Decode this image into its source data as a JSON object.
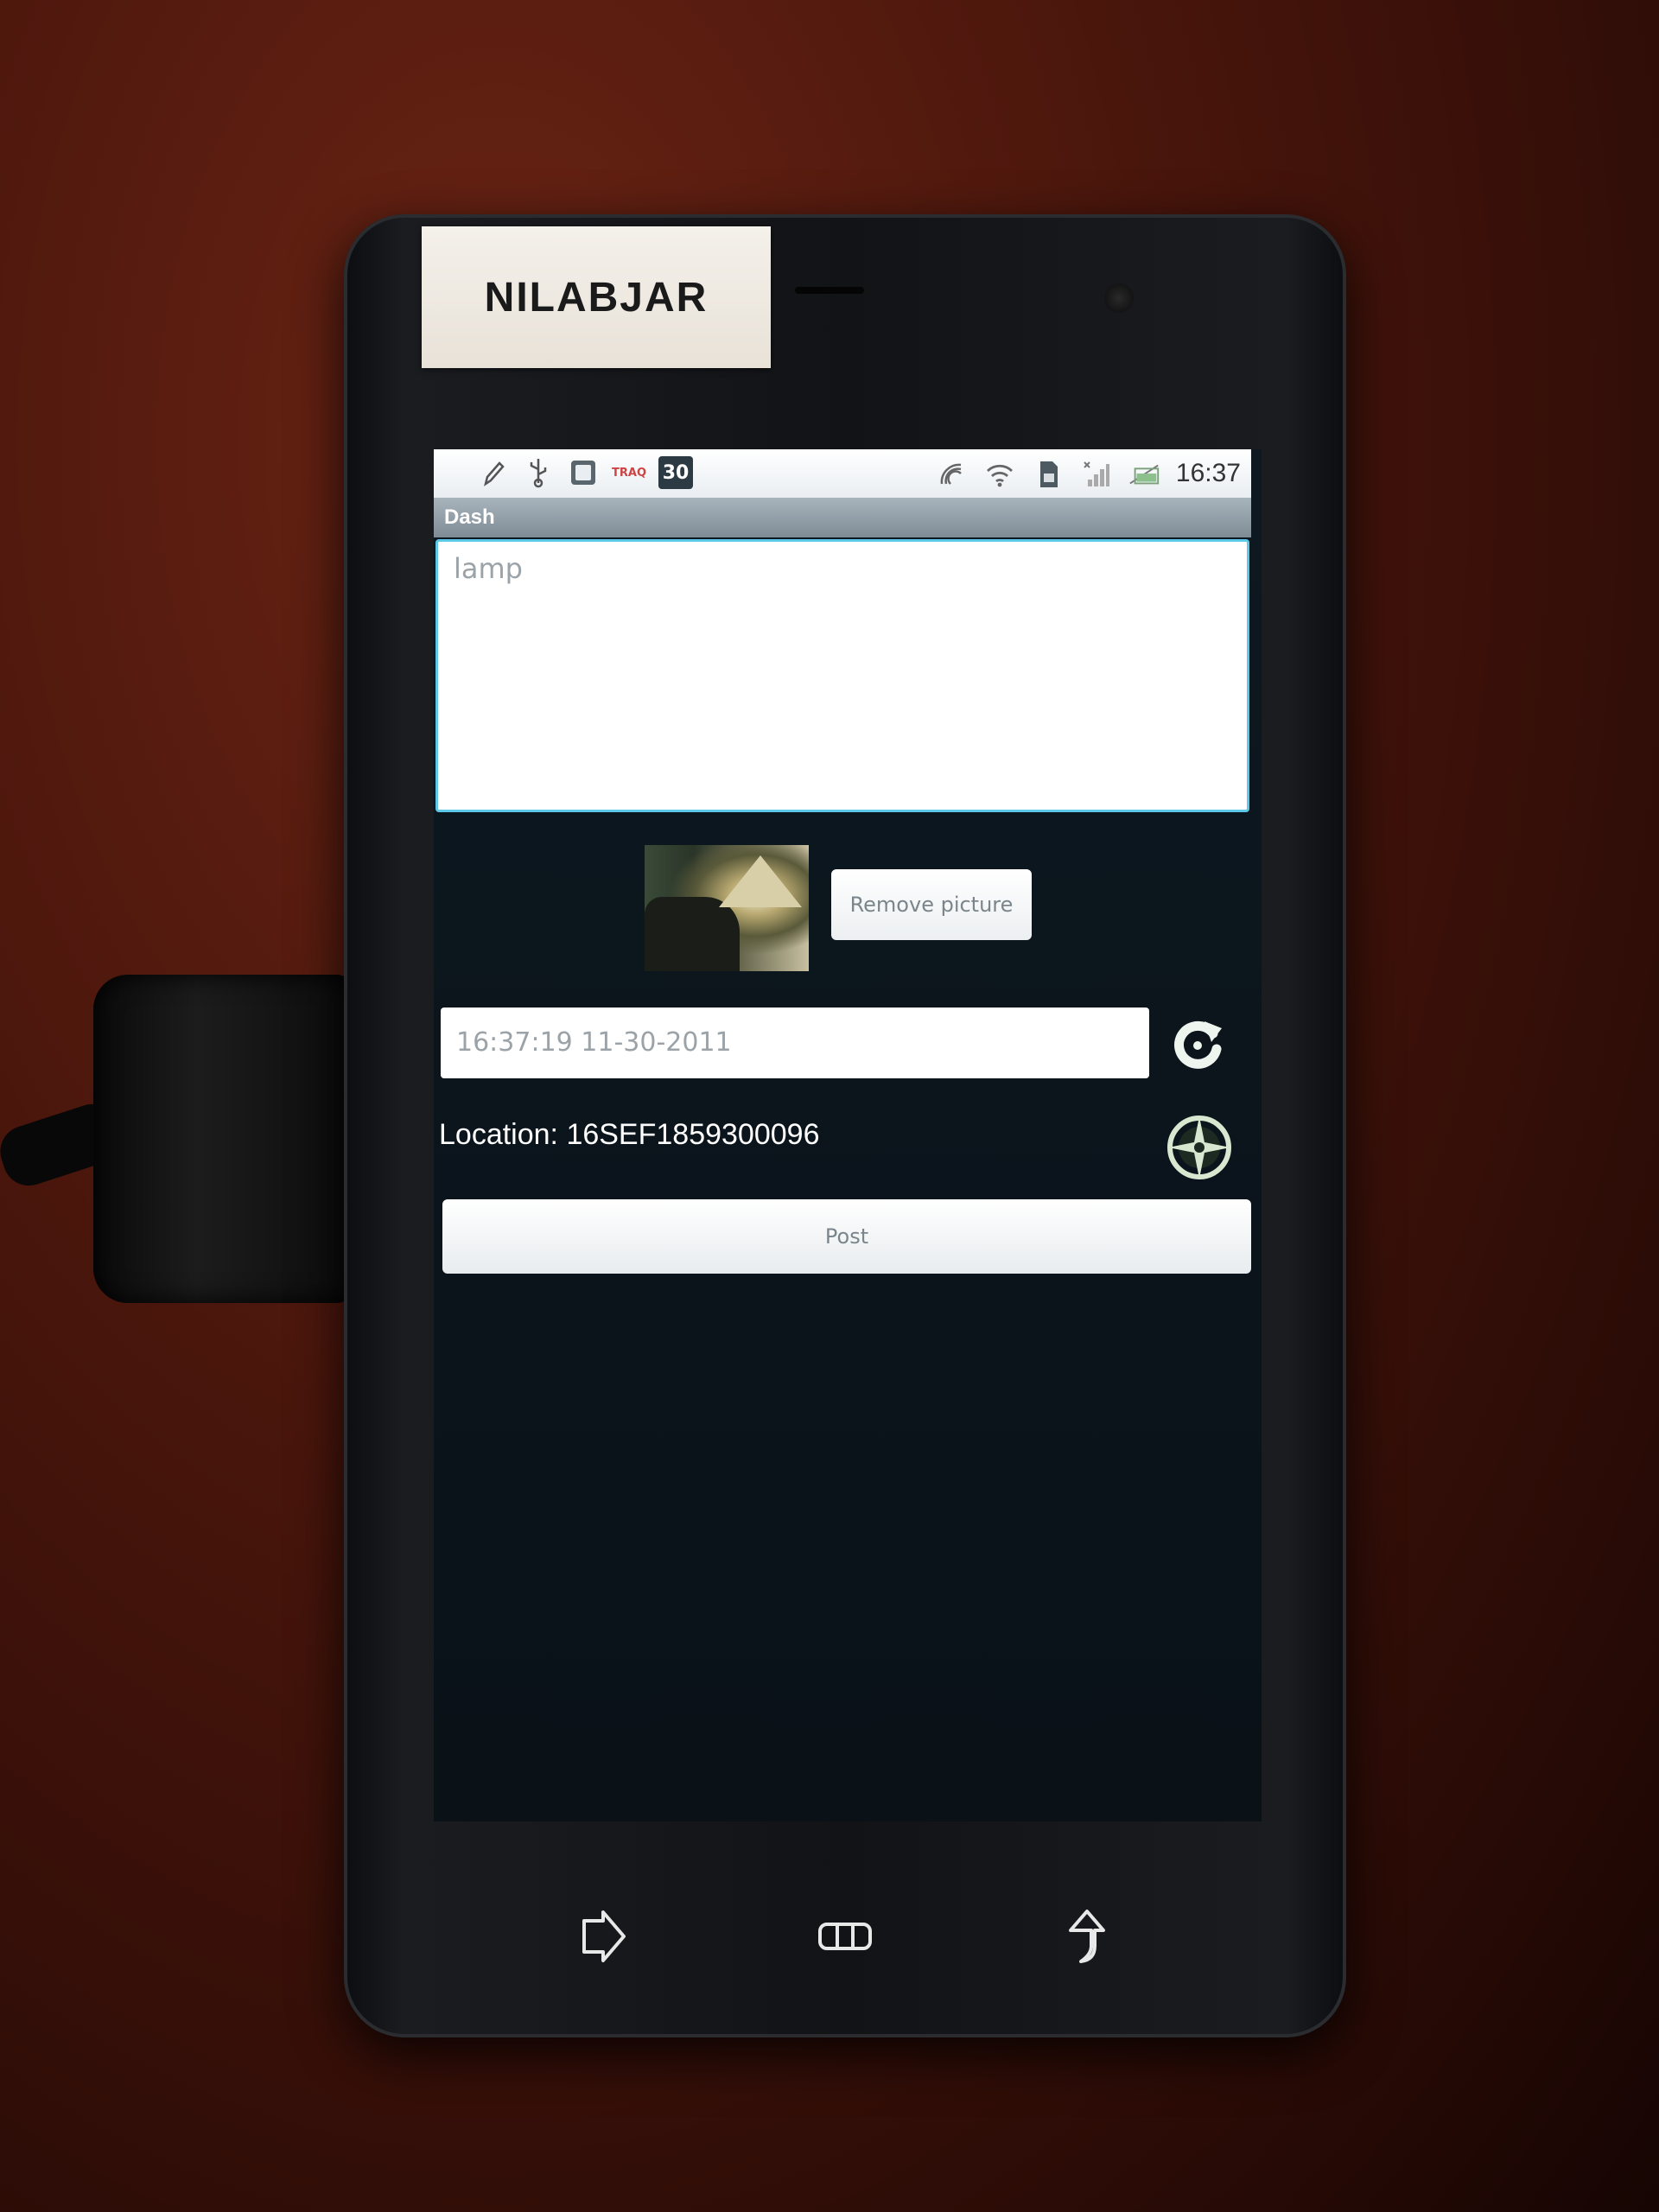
{
  "device": {
    "label_sticker": "NILABJAR"
  },
  "status_bar": {
    "left_icons": [
      "pen-icon",
      "usb-icon",
      "screenshot-icon",
      "traq-icon",
      "calendar-icon"
    ],
    "traq_label": "TRAQ",
    "calendar_day": "30",
    "right_icons": [
      "gps-signal-icon",
      "wifi-icon",
      "sim-icon",
      "signal-icon",
      "battery-icon"
    ],
    "time": "16:37"
  },
  "app": {
    "title": "Dash",
    "text_area": {
      "placeholder": "lamp"
    },
    "remove_picture_label": "Remove picture",
    "datetime_value": "16:37:19 11-30-2011",
    "location_text": "Location: 16SEF1859300096",
    "post_label": "Post"
  },
  "nav_keys": [
    "back-icon",
    "menu-icon",
    "home-icon"
  ],
  "colors": {
    "accent_border": "#5ec8e8",
    "title_bar": "#8f9ca5",
    "screen_bg": "#0d1820"
  }
}
